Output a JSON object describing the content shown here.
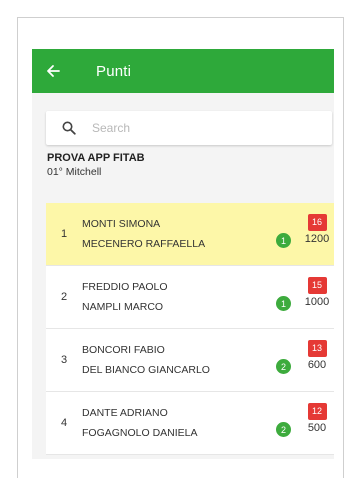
{
  "appbar": {
    "title": "Punti",
    "back_icon": "arrow-left-icon"
  },
  "search": {
    "placeholder": "Search",
    "value": ""
  },
  "event": {
    "title": "PROVA APP FITAB",
    "subtitle": "01° Mitchell"
  },
  "colors": {
    "accent": "#2ea93a",
    "highlight": "#fdf7a8",
    "score_badge": "#e53935",
    "green_badge": "#3dab3d"
  },
  "rows": [
    {
      "rank": "1",
      "player1": "MONTI SIMONA",
      "player2": "MECENERO RAFFAELLA",
      "green": "1",
      "red": "16",
      "points": "1200",
      "highlighted": true
    },
    {
      "rank": "2",
      "player1": "FREDDIO PAOLO",
      "player2": "NAMPLI MARCO",
      "green": "1",
      "red": "15",
      "points": "1000",
      "highlighted": false
    },
    {
      "rank": "3",
      "player1": "BONCORI FABIO",
      "player2": "DEL BIANCO GIANCARLO",
      "green": "2",
      "red": "13",
      "points": "600",
      "highlighted": false
    },
    {
      "rank": "4",
      "player1": "DANTE ADRIANO",
      "player2": "FOGAGNOLO DANIELA",
      "green": "2",
      "red": "12",
      "points": "500",
      "highlighted": false
    }
  ]
}
